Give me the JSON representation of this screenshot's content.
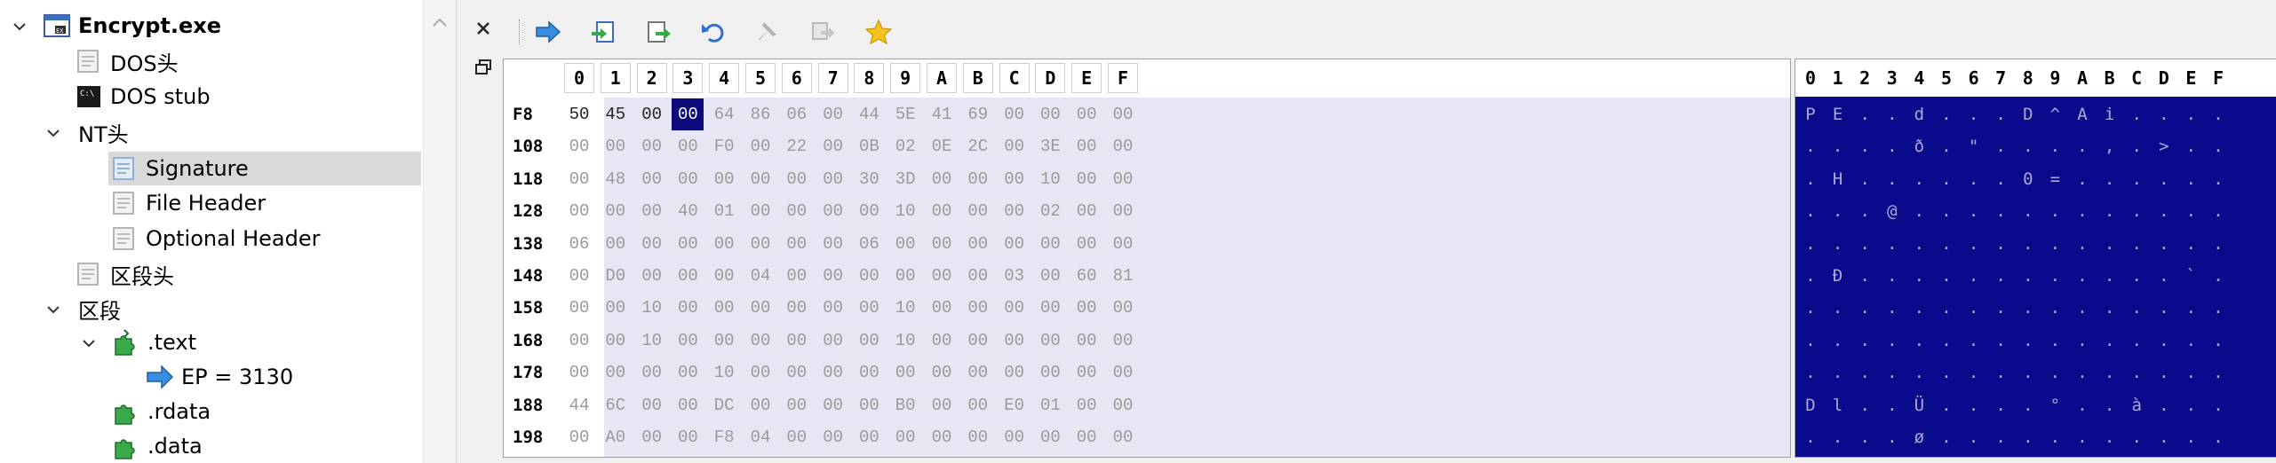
{
  "tree": {
    "nodes": [
      {
        "label": "Encrypt.exe",
        "icon": "exe-icon",
        "expanded": true
      },
      {
        "label": "DOS头",
        "icon": "header-icon"
      },
      {
        "label": "DOS stub",
        "icon": "console-icon"
      },
      {
        "label": "NT头",
        "icon": "none",
        "expanded": true
      },
      {
        "label": "Signature",
        "icon": "header-icon",
        "selected": true
      },
      {
        "label": "File Header",
        "icon": "header-icon"
      },
      {
        "label": "Optional Header",
        "icon": "header-icon"
      },
      {
        "label": "区段头",
        "icon": "header-icon"
      },
      {
        "label": "区段",
        "icon": "none",
        "expanded": true
      },
      {
        "label": ".text",
        "icon": "puzzle-icon",
        "expanded": true
      },
      {
        "label": "EP = 3130",
        "icon": "arrow-right-icon"
      },
      {
        "label": ".rdata",
        "icon": "puzzle-icon"
      },
      {
        "label": ".data",
        "icon": "puzzle-icon"
      }
    ]
  },
  "toolbar": {
    "buttons": [
      "forward-arrow-icon",
      "import-icon",
      "export-icon",
      "undo-icon",
      "pin-icon",
      "goto-icon",
      "favorite-star-icon"
    ]
  },
  "hex": {
    "columns": [
      "0",
      "1",
      "2",
      "3",
      "4",
      "5",
      "6",
      "7",
      "8",
      "9",
      "A",
      "B",
      "C",
      "D",
      "E",
      "F"
    ],
    "rows": [
      {
        "offset": "F8",
        "bytes": [
          "50",
          "45",
          "00",
          "00",
          "64",
          "86",
          "06",
          "00",
          "44",
          "5E",
          "41",
          "69",
          "00",
          "00",
          "00",
          "00"
        ],
        "ascii": [
          "P",
          "E",
          ".",
          ".",
          "d",
          ".",
          ".",
          ".",
          "D",
          "^",
          "A",
          "i",
          ".",
          ".",
          ".",
          "."
        ]
      },
      {
        "offset": "108",
        "bytes": [
          "00",
          "00",
          "00",
          "00",
          "F0",
          "00",
          "22",
          "00",
          "0B",
          "02",
          "0E",
          "2C",
          "00",
          "3E",
          "00",
          "00"
        ],
        "ascii": [
          ".",
          ".",
          ".",
          ".",
          "ð",
          ".",
          "\"",
          ".",
          ".",
          ".",
          ".",
          ",",
          ".",
          ">",
          ".",
          "."
        ]
      },
      {
        "offset": "118",
        "bytes": [
          "00",
          "48",
          "00",
          "00",
          "00",
          "00",
          "00",
          "00",
          "30",
          "3D",
          "00",
          "00",
          "00",
          "10",
          "00",
          "00"
        ],
        "ascii": [
          ".",
          "H",
          ".",
          ".",
          ".",
          ".",
          ".",
          ".",
          "0",
          "=",
          ".",
          ".",
          ".",
          ".",
          ".",
          "."
        ]
      },
      {
        "offset": "128",
        "bytes": [
          "00",
          "00",
          "00",
          "40",
          "01",
          "00",
          "00",
          "00",
          "00",
          "10",
          "00",
          "00",
          "00",
          "02",
          "00",
          "00"
        ],
        "ascii": [
          ".",
          ".",
          ".",
          "@",
          ".",
          ".",
          ".",
          ".",
          ".",
          ".",
          ".",
          ".",
          ".",
          ".",
          ".",
          "."
        ]
      },
      {
        "offset": "138",
        "bytes": [
          "06",
          "00",
          "00",
          "00",
          "00",
          "00",
          "00",
          "00",
          "06",
          "00",
          "00",
          "00",
          "00",
          "00",
          "00",
          "00"
        ],
        "ascii": [
          ".",
          ".",
          ".",
          ".",
          ".",
          ".",
          ".",
          ".",
          ".",
          ".",
          ".",
          ".",
          ".",
          ".",
          ".",
          "."
        ]
      },
      {
        "offset": "148",
        "bytes": [
          "00",
          "D0",
          "00",
          "00",
          "00",
          "04",
          "00",
          "00",
          "00",
          "00",
          "00",
          "00",
          "03",
          "00",
          "60",
          "81"
        ],
        "ascii": [
          ".",
          "Ð",
          ".",
          ".",
          ".",
          ".",
          ".",
          ".",
          ".",
          ".",
          ".",
          ".",
          ".",
          ".",
          "`",
          "."
        ]
      },
      {
        "offset": "158",
        "bytes": [
          "00",
          "00",
          "10",
          "00",
          "00",
          "00",
          "00",
          "00",
          "00",
          "10",
          "00",
          "00",
          "00",
          "00",
          "00",
          "00"
        ],
        "ascii": [
          ".",
          ".",
          ".",
          ".",
          ".",
          ".",
          ".",
          ".",
          ".",
          ".",
          ".",
          ".",
          ".",
          ".",
          ".",
          "."
        ]
      },
      {
        "offset": "168",
        "bytes": [
          "00",
          "00",
          "10",
          "00",
          "00",
          "00",
          "00",
          "00",
          "00",
          "10",
          "00",
          "00",
          "00",
          "00",
          "00",
          "00"
        ],
        "ascii": [
          ".",
          ".",
          ".",
          ".",
          ".",
          ".",
          ".",
          ".",
          ".",
          ".",
          ".",
          ".",
          ".",
          ".",
          ".",
          "."
        ]
      },
      {
        "offset": "178",
        "bytes": [
          "00",
          "00",
          "00",
          "00",
          "10",
          "00",
          "00",
          "00",
          "00",
          "00",
          "00",
          "00",
          "00",
          "00",
          "00",
          "00"
        ],
        "ascii": [
          ".",
          ".",
          ".",
          ".",
          ".",
          ".",
          ".",
          ".",
          ".",
          ".",
          ".",
          ".",
          ".",
          ".",
          ".",
          "."
        ]
      },
      {
        "offset": "188",
        "bytes": [
          "44",
          "6C",
          "00",
          "00",
          "DC",
          "00",
          "00",
          "00",
          "00",
          "B0",
          "00",
          "00",
          "E0",
          "01",
          "00",
          "00"
        ],
        "ascii": [
          "D",
          "l",
          ".",
          ".",
          "Ü",
          ".",
          ".",
          ".",
          ".",
          "°",
          ".",
          ".",
          "à",
          ".",
          ".",
          "."
        ]
      },
      {
        "offset": "198",
        "bytes": [
          "00",
          "A0",
          "00",
          "00",
          "F8",
          "04",
          "00",
          "00",
          "00",
          "00",
          "00",
          "00",
          "00",
          "00",
          "00",
          "00"
        ],
        "ascii": [
          ".",
          ".",
          ".",
          ".",
          "ø",
          ".",
          ".",
          ".",
          ".",
          ".",
          ".",
          ".",
          ".",
          ".",
          ".",
          "."
        ]
      }
    ],
    "selected": {
      "row": 0,
      "col": 3
    },
    "dark_bytes_in_first_row": 3
  },
  "colors": {
    "selection": "#0a0a7a",
    "ascii_bg": "#0a0a8c",
    "hex_bg": "#e6e6f4",
    "tree_selected": "#d9d9d9"
  }
}
